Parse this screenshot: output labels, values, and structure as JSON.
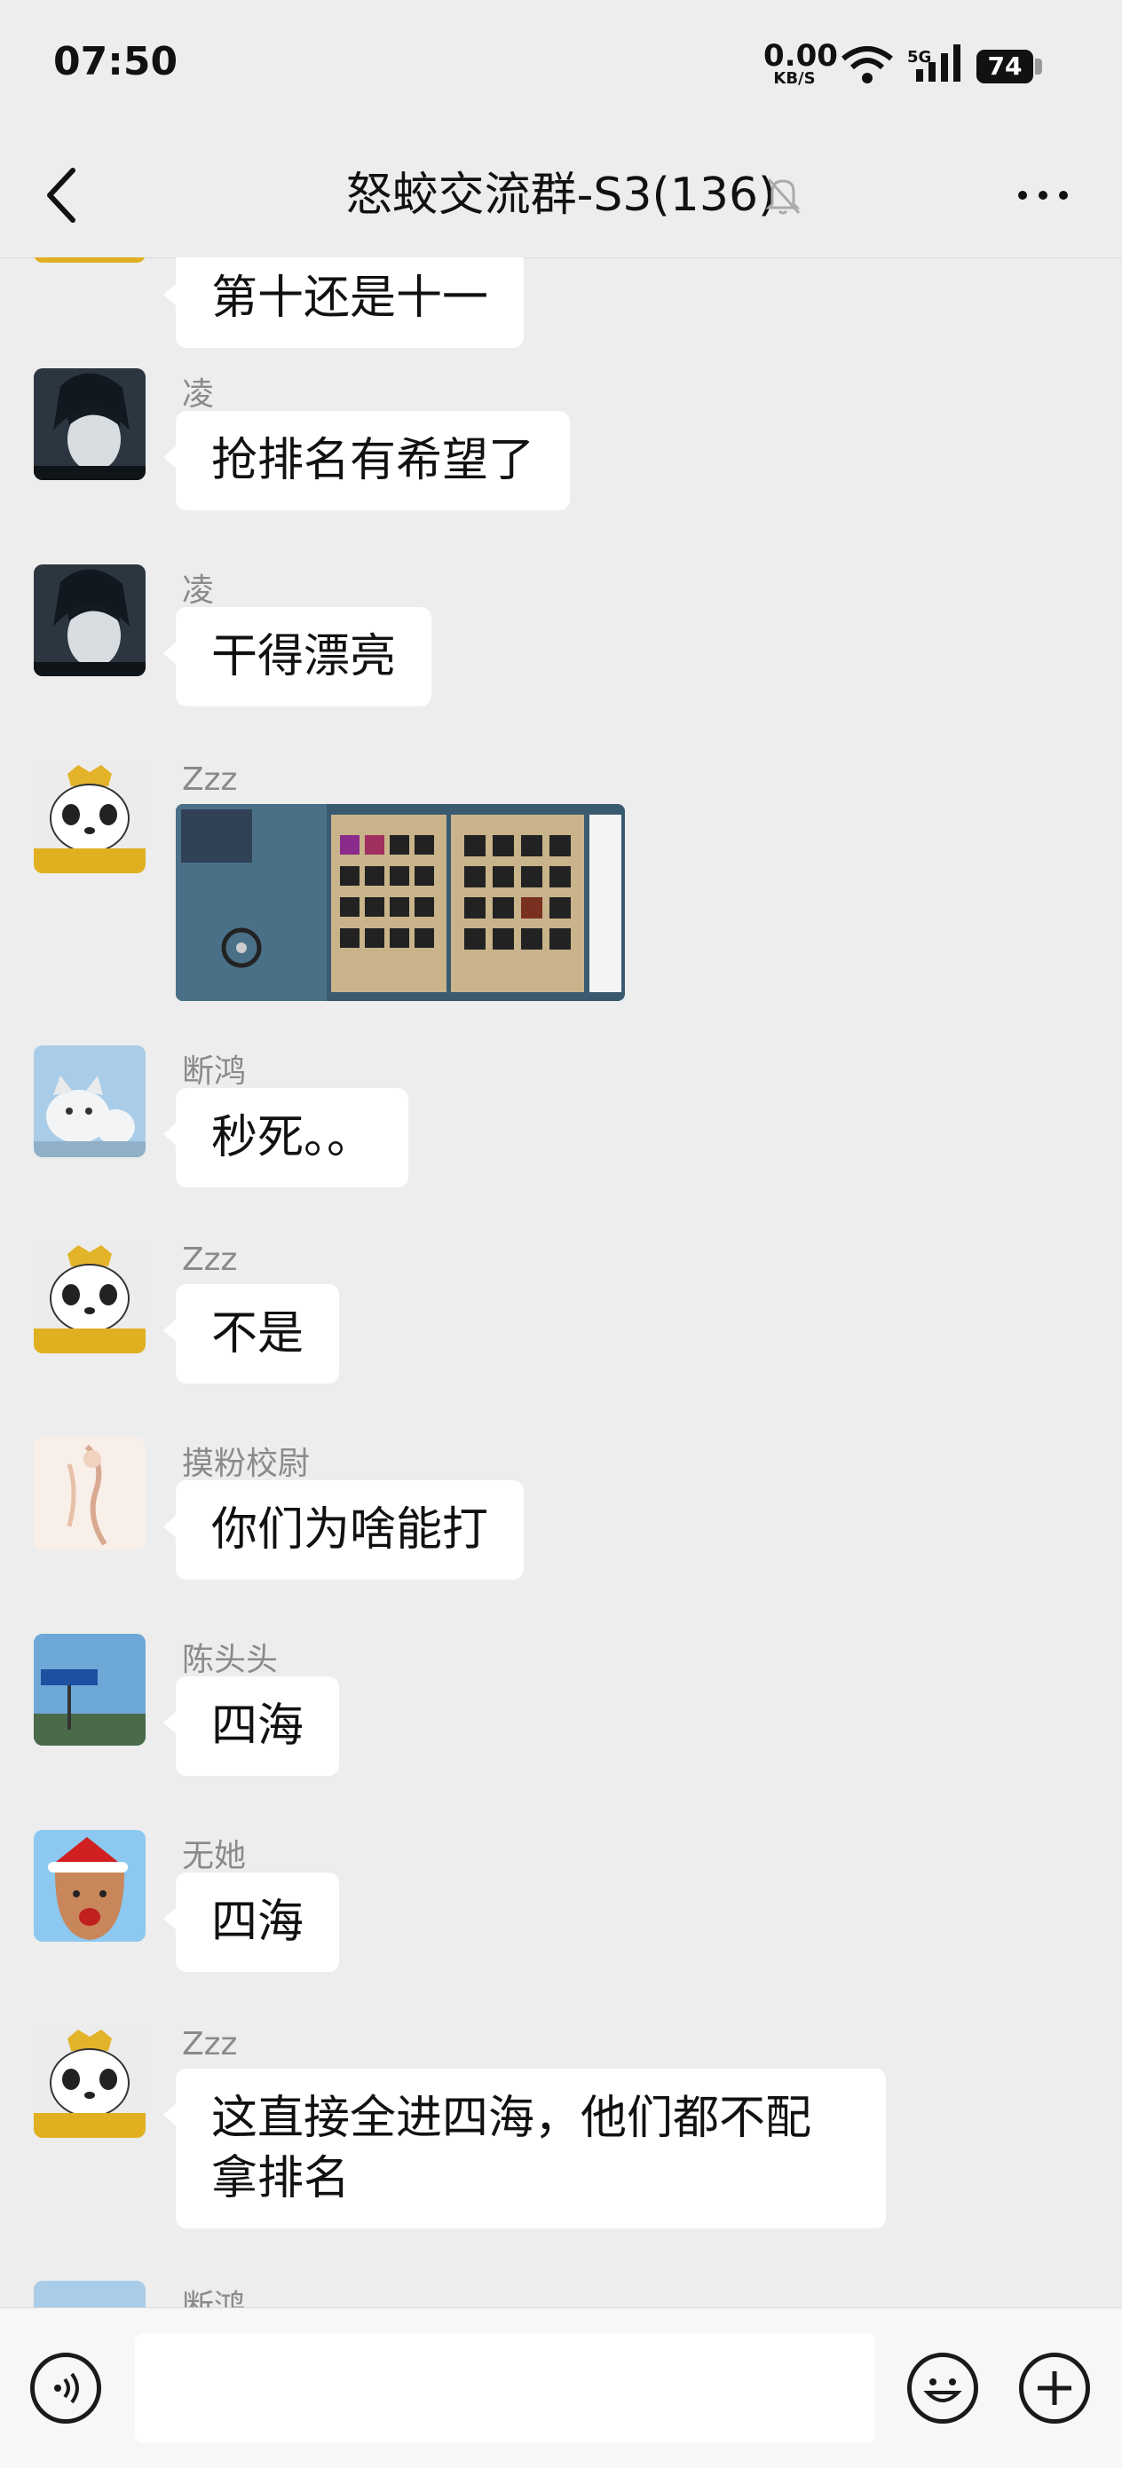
{
  "status_bar": {
    "time": "07:50",
    "net_speed": "0.00",
    "net_unit": "KB/S",
    "network_type": "5G",
    "battery": "74"
  },
  "header": {
    "title": "怒蛟交流群-S3(136)",
    "back_icon": "chevron-left-icon",
    "mute_icon": "bell-off-icon",
    "more_icon": "more-dots-icon"
  },
  "messages": [
    {
      "sender": "",
      "text": "第十还是十一"
    },
    {
      "sender": "凌",
      "text": "抢排名有希望了"
    },
    {
      "sender": "凌",
      "text": "干得漂亮"
    },
    {
      "sender": "Zzz",
      "image": "game-screenshot-thumbnail"
    },
    {
      "sender": "断鸿",
      "text": "秒死。。"
    },
    {
      "sender": "Zzz",
      "text": "不是"
    },
    {
      "sender": "摸粉校尉",
      "text": "你们为啥能打"
    },
    {
      "sender": "陈头头",
      "text": "四海"
    },
    {
      "sender": "无她",
      "text": "四海"
    },
    {
      "sender": "Zzz",
      "text": "这直接全进四海，他们都不配拿排名"
    },
    {
      "sender": "断鸿",
      "text": ""
    }
  ],
  "input_bar": {
    "voice_icon": "voice-icon",
    "emoji_icon": "emoji-icon",
    "plus_icon": "plus-icon",
    "text": ""
  },
  "colors": {
    "background": "#ededed",
    "bubble": "#ffffff",
    "sender_name": "#8a8a8a"
  }
}
